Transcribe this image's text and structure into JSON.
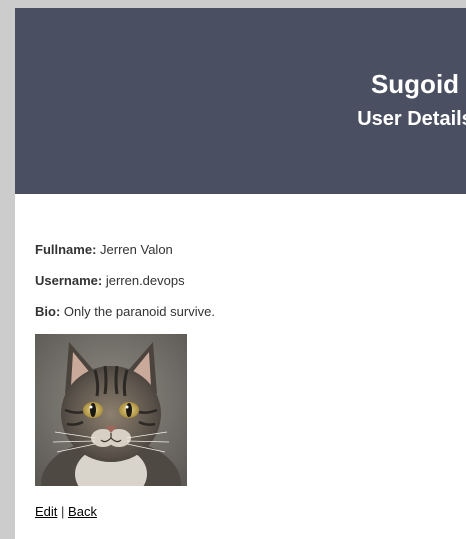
{
  "header": {
    "site_title": "Sugoid",
    "page_title": "User Details"
  },
  "user": {
    "fullname_label": "Fullname:",
    "fullname": "Jerren Valon",
    "username_label": "Username:",
    "username": "jerren.devops",
    "bio_label": "Bio:",
    "bio": "Only the paranoid survive."
  },
  "actions": {
    "edit_label": "Edit",
    "separator": "|",
    "back_label": "Back"
  },
  "colors": {
    "header_bg": "#4a5061",
    "page_bg": "#ffffff",
    "outer_bg": "#cccccc"
  }
}
